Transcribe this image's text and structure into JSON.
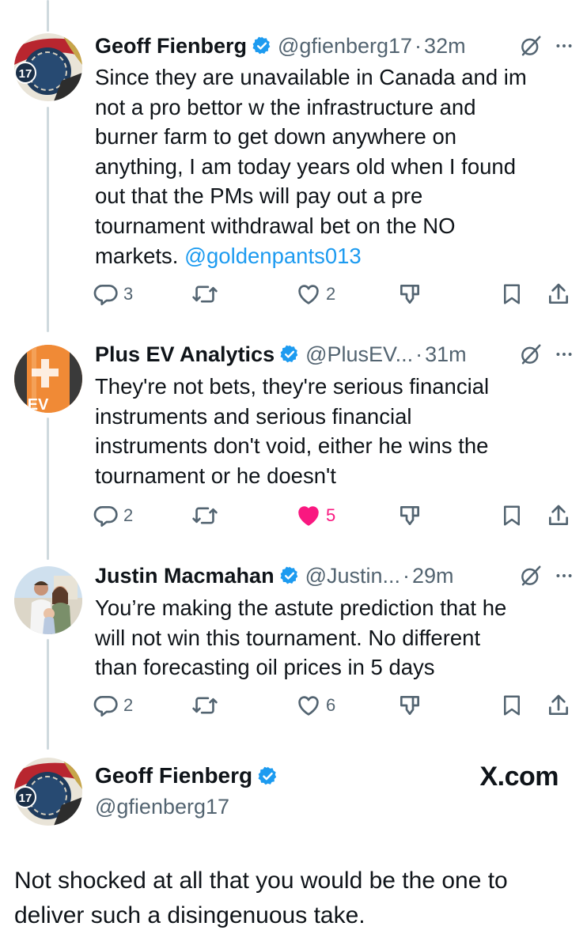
{
  "replies": [
    {
      "name": "Geoff Fienberg",
      "handle": "@gfienberg17",
      "dot": "·",
      "time": "32m",
      "text": "Since they are unavailable in Canada and im\nnot a pro bettor w the infrastructure and\nburner farm to get down anywhere on\nanything, I am today years old when I found\nout that the PMs will pay out a pre\ntournament withdrawal bet on the NO\nmarkets. ",
      "mention": "@goldenpants013",
      "replies_count": "3",
      "likes_count": "2",
      "liked": false
    },
    {
      "name": "Plus EV Analytics",
      "handle": "@PlusEV...",
      "dot": "·",
      "time": "31m",
      "text": "They're not bets, they're serious financial\ninstruments and serious financial\ninstruments don't void, either he wins the\ntournament or he doesn't",
      "replies_count": "2",
      "likes_count": "5",
      "liked": true
    },
    {
      "name": "Justin Macmahan",
      "handle": "@Justin...",
      "dot": "·",
      "time": "29m",
      "text": "You’re making the astute prediction that he\nwill not win this tournament. No different\nthan forecasting oil prices in 5 days",
      "replies_count": "2",
      "likes_count": "6",
      "liked": false
    }
  ],
  "main": {
    "name": "Geoff Fienberg",
    "handle": "@gfienberg17",
    "watermark": "X.com",
    "text": "Not shocked at all that you would be the one to deliver such a disingenuous take."
  },
  "avatars": {
    "plus_ev_badge": "EV",
    "geoff_badge": "17"
  },
  "icons": [
    "reply-icon",
    "repost-icon",
    "like-icon",
    "views-icon",
    "bookmark-icon",
    "share-icon",
    "verified-icon",
    "grok-icon",
    "more-icon"
  ],
  "colors": {
    "accent": "#1d9bf0",
    "like": "#f91880",
    "secondary_text": "#536471",
    "verified": "#1d9bf0"
  }
}
